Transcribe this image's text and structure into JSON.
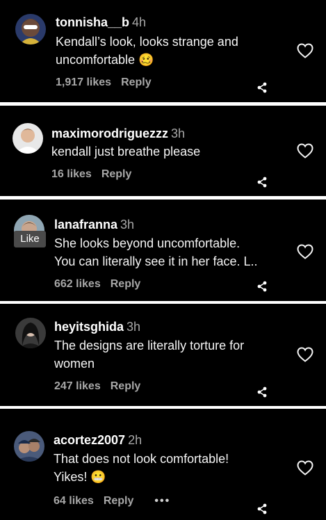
{
  "comments": [
    {
      "username": "tonnisha__b",
      "time": "4h",
      "text": "Kendall’s look, looks strange and\nuncomfortable 🥴",
      "likes": "1,917 likes",
      "reply": "Reply"
    },
    {
      "username": "maximorodriguezzz",
      "time": "3h",
      "text": "kendall just breathe please",
      "likes": "16 likes",
      "reply": "Reply"
    },
    {
      "username": "lanafranna",
      "time": "3h",
      "text": "She looks beyond uncomfortable.\nYou can literally see it in her face. L..",
      "likes": "662 likes",
      "reply": "Reply",
      "hover_label": "Like"
    },
    {
      "username": "heyitsghida",
      "time": "3h",
      "text": "The designs are literally torture for\nwomen",
      "likes": "247 likes",
      "reply": "Reply"
    },
    {
      "username": "acortez2007",
      "time": "2h",
      "text": "That does not look comfortable!\nYikes! 😬",
      "likes": "64 likes",
      "reply": "Reply",
      "more": "•••"
    }
  ],
  "icons": {
    "heart": "heart-outline-icon",
    "share": "share-icon",
    "more": "more-options-icon"
  },
  "colors": {
    "background": "#000000",
    "separator": "#ffffff",
    "text": "#f5f5f5",
    "muted": "#a8a8a8"
  }
}
